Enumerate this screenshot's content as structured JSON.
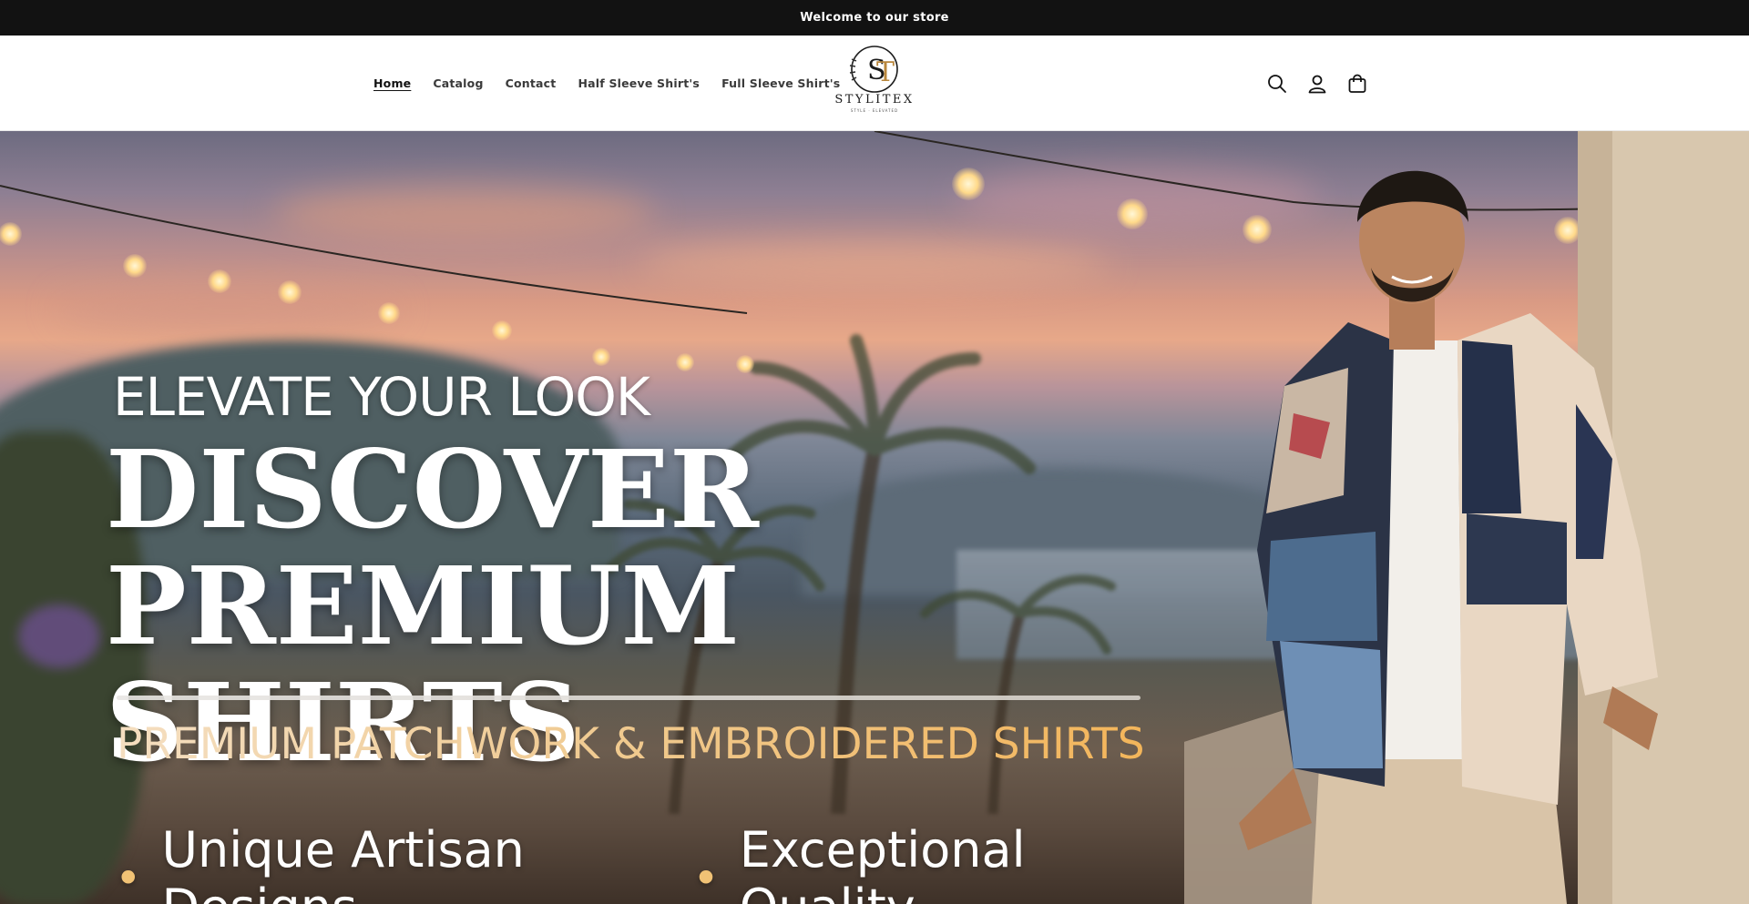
{
  "announcement": {
    "text": "Welcome to our store"
  },
  "nav": {
    "items": [
      {
        "label": "Home",
        "active": true
      },
      {
        "label": "Catalog",
        "active": false
      },
      {
        "label": "Contact",
        "active": false
      },
      {
        "label": "Half Sleeve Shirt's",
        "active": false
      },
      {
        "label": "Full Sleeve Shirt's",
        "active": false
      }
    ]
  },
  "logo": {
    "monogram": "ST",
    "brand": "STYLITEX",
    "tagline": "STYLE · ELEVATED"
  },
  "header_icons": [
    {
      "name": "search-icon"
    },
    {
      "name": "account-icon"
    },
    {
      "name": "cart-icon"
    }
  ],
  "hero": {
    "eyebrow": "ELEVATE YOUR LOOK",
    "headline_line1": "DISCOVER",
    "headline_line2": "PREMIUM SHIRTS",
    "subline": "PREMIUM PATCHWORK & EMBROIDERED SHIRTS",
    "bullets": [
      "Unique Artisan Designs",
      "Exceptional Quality"
    ],
    "bullet_symbol": "•"
  },
  "colors": {
    "announcement_bg": "#121212",
    "text": "#121212",
    "accent_gold": "#f0c98e"
  }
}
